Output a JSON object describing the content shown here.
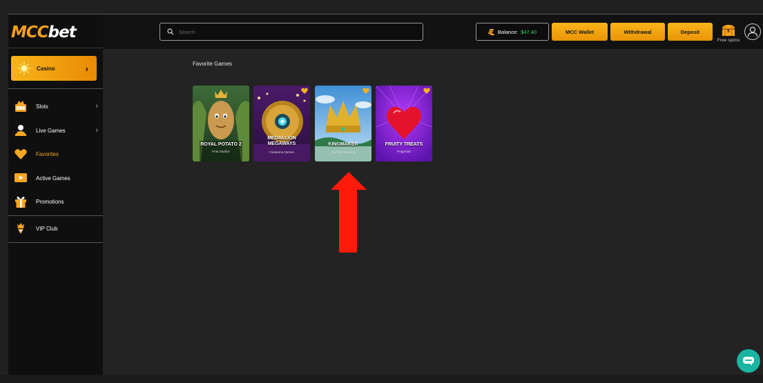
{
  "brand": {
    "logo_left": "MCC",
    "logo_right": "bet"
  },
  "sidebar": {
    "casino_label": "Casino",
    "items": [
      {
        "label": "Slots",
        "icon": "slots-icon",
        "has_chevron": true
      },
      {
        "label": "Live Games",
        "icon": "dealer-icon",
        "has_chevron": true
      },
      {
        "label": "Favorites",
        "icon": "heart-icon",
        "active": true
      },
      {
        "label": "Active Games",
        "icon": "play-icon"
      },
      {
        "label": "Promotions",
        "icon": "gift-icon"
      }
    ],
    "vip_label": "VIP Club"
  },
  "header": {
    "search_placeholder": "Search",
    "balance_label": "Balance:",
    "balance_value": "$47.40",
    "wallet_label": "MCC Wallet",
    "withdrawal_label": "Withdrawal",
    "deposit_label": "Deposit",
    "free_spins_label": "Free spins"
  },
  "main": {
    "section_title": "Favorite Games",
    "games": [
      {
        "title": "ROYAL POTATO 2",
        "provider": "Print Studios"
      },
      {
        "title": "MEDALLION MEGAWAYS",
        "title_lines": [
          "MEDALLION",
          "MEGAWAYS"
        ],
        "provider": "Fantasma Games"
      },
      {
        "title": "KINGMAKER",
        "provider": "Big Time Gaming"
      },
      {
        "title": "FRUITY TREATS",
        "provider": "Pragmatic"
      }
    ]
  },
  "colors": {
    "accent": "#f5a623",
    "balance_green": "#3ed36a",
    "chat": "#19b5a0",
    "arrow": "#ff1a0a"
  }
}
